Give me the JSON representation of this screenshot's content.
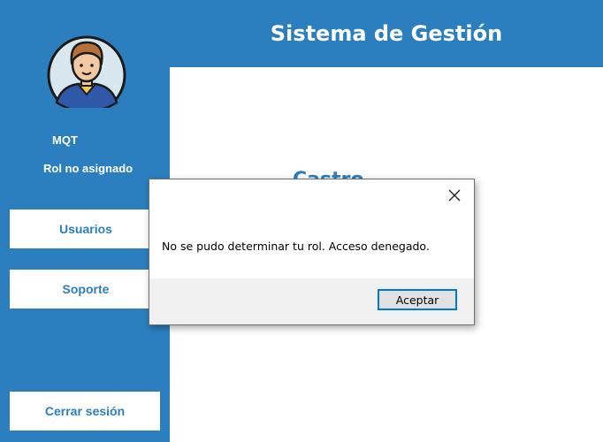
{
  "header": {
    "title": "Sistema de Gestión"
  },
  "user": {
    "name": "MQT",
    "role": "Rol no asignado"
  },
  "sidebar": {
    "items": [
      {
        "label": "Usuarios"
      },
      {
        "label": "Soporte"
      }
    ],
    "logout_label": "Cerrar sesión"
  },
  "main": {
    "welcome_partial": "Castro"
  },
  "dialog": {
    "message": "No se pudo determinar tu rol. Acceso denegado.",
    "accept_label": "Aceptar",
    "close_icon": "close-icon"
  },
  "colors": {
    "primary": "#2b7fbf",
    "dialog_footer": "#f0f0f0",
    "accent_border": "#0078d7"
  }
}
